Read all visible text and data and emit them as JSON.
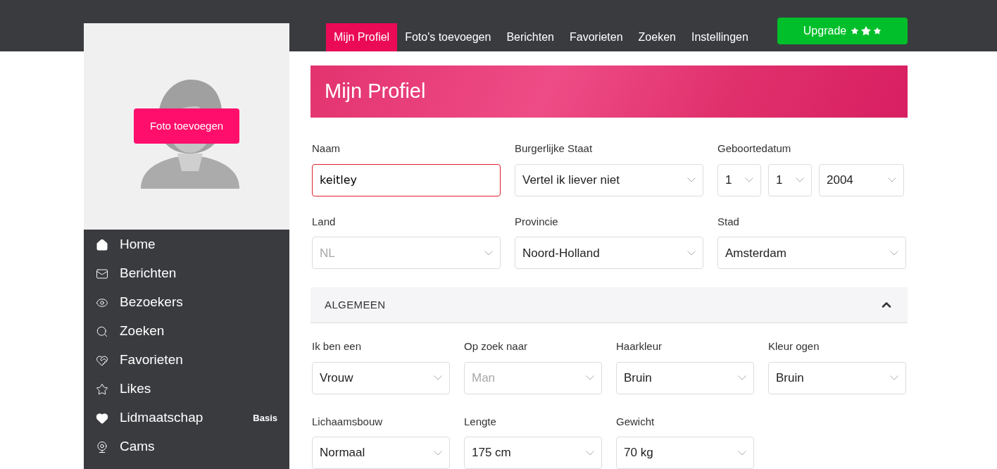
{
  "photo": {
    "button": "Foto toevoegen"
  },
  "sidebar": {
    "items": [
      {
        "label": "Home"
      },
      {
        "label": "Berichten"
      },
      {
        "label": "Bezoekers"
      },
      {
        "label": "Zoeken"
      },
      {
        "label": "Favorieten"
      },
      {
        "label": "Likes"
      },
      {
        "label": "Lidmaatschap",
        "badge": "Basis"
      },
      {
        "label": "Cams"
      }
    ]
  },
  "top_nav": {
    "tabs": [
      {
        "label": "Mijn Profiel",
        "selected": true
      },
      {
        "label": "Foto's toevoegen",
        "selected": false
      },
      {
        "label": "Berichten",
        "selected": false
      },
      {
        "label": "Favorieten",
        "selected": false
      },
      {
        "label": "Zoeken",
        "selected": false
      },
      {
        "label": "Instellingen",
        "selected": false
      }
    ],
    "upgrade": {
      "label": "Upgrade",
      "stars": 3
    }
  },
  "page_title": "Mijn Profiel",
  "basic_fields": [
    {
      "label": "Naam",
      "kind": "text",
      "value": "keitley",
      "invalid": true
    },
    {
      "label": "Burgerlijke Staat",
      "kind": "select",
      "value": "Vertel ik liever niet",
      "disabled": false
    },
    {
      "label": "Geboortedatum",
      "kind": "date",
      "parts": [
        "1",
        "1",
        "2004"
      ]
    },
    {
      "label": "Land",
      "kind": "select",
      "value": "NL",
      "disabled": true
    },
    {
      "label": "Provincie",
      "kind": "select",
      "value": "Noord-Holland",
      "disabled": false
    },
    {
      "label": "Stad",
      "kind": "select",
      "value": "Amsterdam",
      "disabled": false
    }
  ],
  "section": {
    "title": "ALGEMEEN",
    "expanded": true,
    "fields": [
      {
        "label": "Ik ben een",
        "value": "Vrouw",
        "disabled": false
      },
      {
        "label": "Op zoek naar",
        "value": "Man",
        "disabled": true
      },
      {
        "label": "Haarkleur",
        "value": "Bruin",
        "disabled": false
      },
      {
        "label": "Kleur ogen",
        "value": "Bruin",
        "disabled": false
      },
      {
        "label": "Lichaamsbouw",
        "value": "Normaal",
        "disabled": false
      },
      {
        "label": "Lengte",
        "value": "175 cm",
        "disabled": false
      },
      {
        "label": "Gewicht",
        "value": "70 kg",
        "disabled": false
      }
    ]
  }
}
